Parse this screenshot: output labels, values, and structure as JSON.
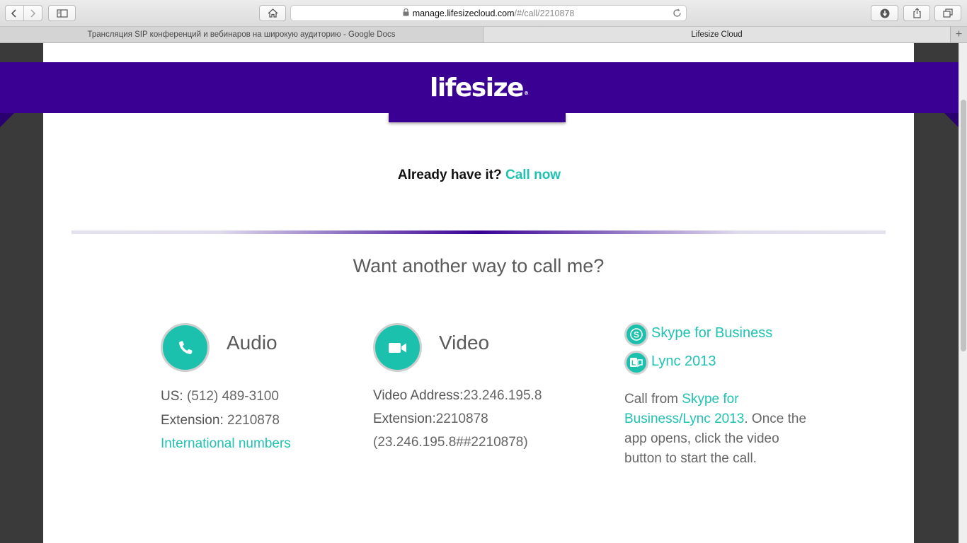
{
  "browser": {
    "url_host": "manage.lifesizecloud.com",
    "url_path": "/#/call/2210878",
    "tabs": [
      {
        "label": "Трансляция SIP конференций и вебинаров на широкую аудиторию - Google Docs",
        "active": false
      },
      {
        "label": "Lifesize Cloud",
        "active": true
      }
    ],
    "icons": [
      "back-icon",
      "forward-icon",
      "sidebar-icon",
      "home-icon",
      "lock-icon",
      "reload-icon",
      "download-icon",
      "share-icon",
      "tabs-icon",
      "new-tab-icon"
    ]
  },
  "header": {
    "logo_text": "lifesize",
    "logo_mark": "®",
    "brand_color": "#3a0094"
  },
  "main": {
    "already_text": "Already have it?",
    "call_now_label": "Call now",
    "accent_color": "#1fc2b1",
    "want_heading": "Want another way to call me?"
  },
  "audio": {
    "title": "Audio",
    "us_label": "US:",
    "us_number": "(512) 489-3100",
    "extension_label": "Extension:",
    "extension_value": "2210878",
    "international_link": "International numbers"
  },
  "video": {
    "title": "Video",
    "address_label": "Video Address:",
    "address_value": "23.246.195.8",
    "extension_label": "Extension:",
    "extension_value": "2210878",
    "full_address": "(23.246.195.8##2210878)"
  },
  "apps": {
    "skype_label": "Skype for Business",
    "lync_label": "Lync 2013",
    "desc_prefix": "Call from",
    "desc_link": "Skype for Business/Lync 2013",
    "desc_suffix": ". Once the app opens, click the video button to start the call."
  }
}
